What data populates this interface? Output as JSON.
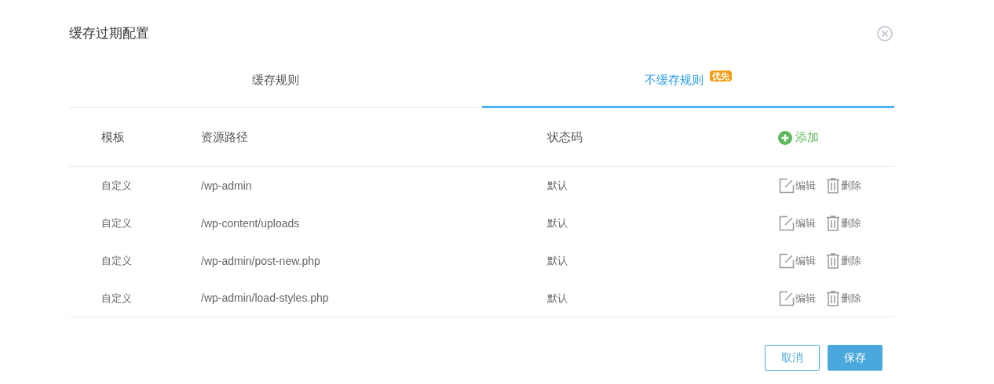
{
  "dialog": {
    "title": "缓存过期配置"
  },
  "tabs": [
    {
      "label": "缓存规则",
      "selected": false
    },
    {
      "label": "不缓存规则",
      "selected": true,
      "badge": "优先"
    }
  ],
  "table": {
    "columns": [
      "模板",
      "资源路径",
      "状态码"
    ],
    "add_action": "添加",
    "rows": [
      {
        "template": "自定义",
        "path": "/wp-admin",
        "status": "默认",
        "actions": [
          "编辑",
          "删除"
        ]
      },
      {
        "template": "自定义",
        "path": "/wp-content/uploads",
        "status": "默认",
        "actions": [
          "编辑",
          "删除"
        ]
      },
      {
        "template": "自定义",
        "path": "/wp-admin/post-new.php",
        "status": "默认",
        "actions": [
          "编辑",
          "删除"
        ]
      },
      {
        "template": "自定义",
        "path": "/wp-admin/load-styles.php",
        "status": "默认",
        "actions": [
          "编辑",
          "删除"
        ]
      }
    ]
  },
  "buttons": [
    {
      "label": "取消",
      "kind": "secondary"
    },
    {
      "label": "保存",
      "kind": "primary"
    }
  ]
}
